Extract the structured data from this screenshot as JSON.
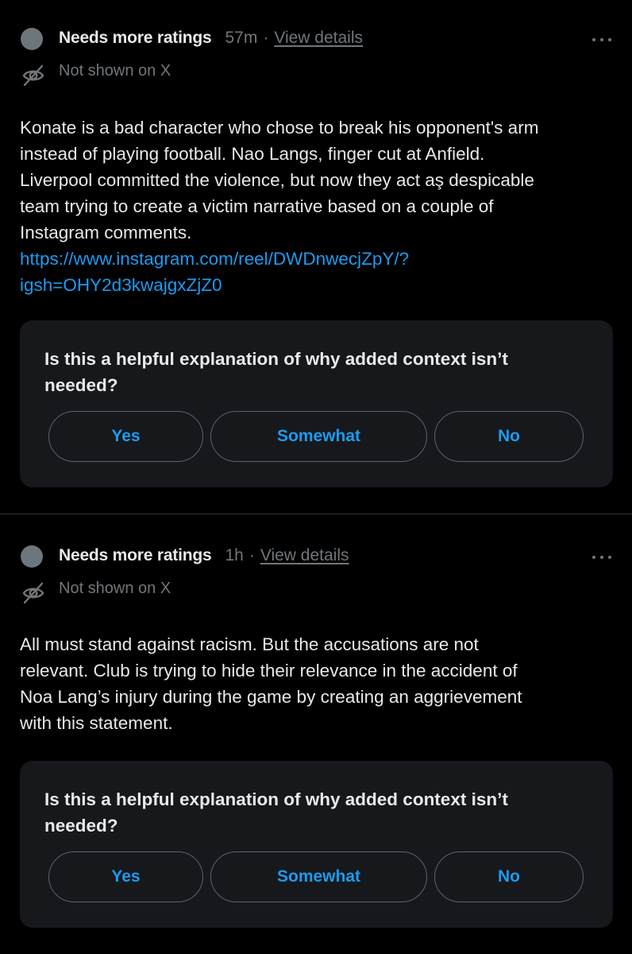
{
  "notes": [
    {
      "status": "Needs more ratings",
      "time": "57m",
      "separator": "·",
      "details_link": "View details",
      "visibility": "Not shown on X",
      "body_lines": [
        "Konate is a bad character who chose to break his opponent's arm",
        "instead of playing football. Nao Langs, finger cut  at Anfield.",
        "Liverpool committed the violence, but now they act aş despicable",
        "team trying to create a victim narrative based on a couple of",
        "Instagram comments."
      ],
      "link_lines": [
        "https://www.instagram.com/reel/DWDnwecjZpY/?",
        "igsh=OHY2d3kwajgxZjZ0"
      ],
      "question": "Is this a helpful explanation of why added context isn’t needed?",
      "buttons": {
        "yes": "Yes",
        "somewhat": "Somewhat",
        "no": "No"
      }
    },
    {
      "status": "Needs more ratings",
      "time": "1h",
      "separator": "·",
      "details_link": "View details",
      "visibility": "Not shown on X",
      "body_lines": [
        "All must stand against racism. But the accusations are not",
        "relevant. Club is trying to hide their relevance in the accident of",
        "Noa Lang’s injury during the game by creating an aggrievement",
        "with this statement."
      ],
      "question": "Is this a helpful explanation of why added context isn’t needed?",
      "buttons": {
        "yes": "Yes",
        "somewhat": "Somewhat",
        "no": "No"
      }
    }
  ],
  "icons": {
    "avatar": "gray-circle-avatar",
    "visibility": "eye-off-icon",
    "more": "more-horizontal-icon"
  },
  "colors": {
    "background": "#000000",
    "card": "#16181c",
    "text": "#e7e9ea",
    "muted": "#71767b",
    "accent": "#1d9bf0",
    "button_border": "#536471"
  }
}
